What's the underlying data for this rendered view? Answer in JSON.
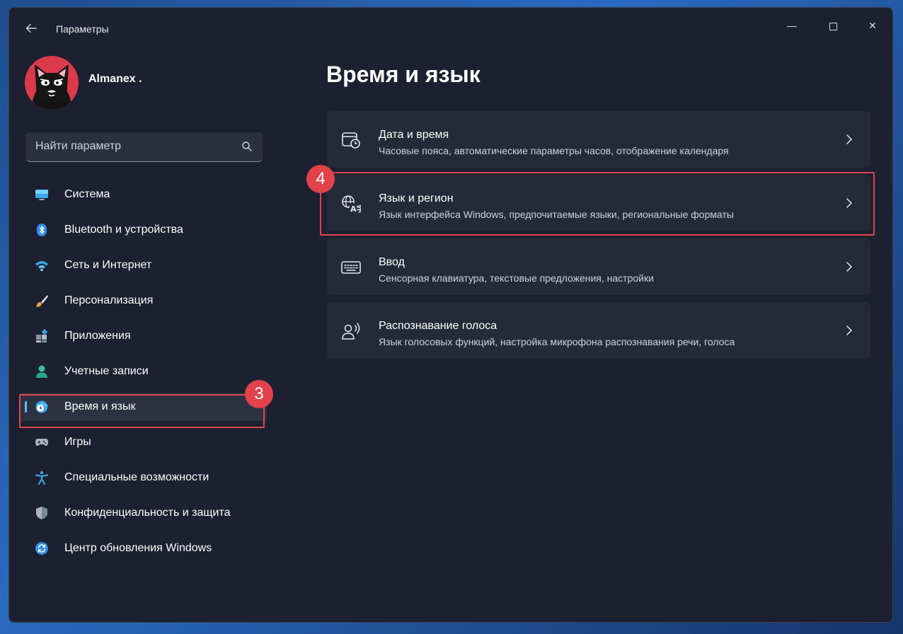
{
  "window": {
    "title": "Параметры",
    "controls": {
      "minimize": "—",
      "close": "✕"
    }
  },
  "profile": {
    "name": "Almanex ."
  },
  "search": {
    "placeholder": "Найти параметр"
  },
  "sidebar": {
    "items": [
      {
        "label": "Система",
        "icon": "monitor-icon"
      },
      {
        "label": "Bluetooth и устройства",
        "icon": "bluetooth-icon"
      },
      {
        "label": "Сеть и Интернет",
        "icon": "wifi-icon"
      },
      {
        "label": "Персонализация",
        "icon": "brush-icon"
      },
      {
        "label": "Приложения",
        "icon": "apps-icon"
      },
      {
        "label": "Учетные записи",
        "icon": "person-icon"
      },
      {
        "label": "Время и язык",
        "icon": "globe-clock-icon",
        "active": true
      },
      {
        "label": "Игры",
        "icon": "gamepad-icon"
      },
      {
        "label": "Специальные возможности",
        "icon": "accessibility-icon"
      },
      {
        "label": "Конфиденциальность и защита",
        "icon": "shield-icon"
      },
      {
        "label": "Центр обновления Windows",
        "icon": "update-icon"
      }
    ]
  },
  "main": {
    "title": "Время и язык",
    "cards": [
      {
        "title": "Дата и время",
        "subtitle": "Часовые пояса, автоматические параметры часов, отображение календаря",
        "icon": "calendar-clock-icon"
      },
      {
        "title": "Язык и регион",
        "subtitle": "Язык интерфейса Windows, предпочитаемые языки, региональные форматы",
        "icon": "language-icon"
      },
      {
        "title": "Ввод",
        "subtitle": "Сенсорная клавиатура, текстовые предложения, настройки",
        "icon": "keyboard-icon"
      },
      {
        "title": "Распознавание голоса",
        "subtitle": "Язык голосовых функций, настройка микрофона распознавания речи, голоса",
        "icon": "voice-icon"
      }
    ]
  },
  "annotations": {
    "step3": "3",
    "step4": "4"
  },
  "colors": {
    "accent": "#5cc0f4",
    "highlight": "#e0454f",
    "window_bg": "#1c2030",
    "card_bg": "#252a39"
  }
}
